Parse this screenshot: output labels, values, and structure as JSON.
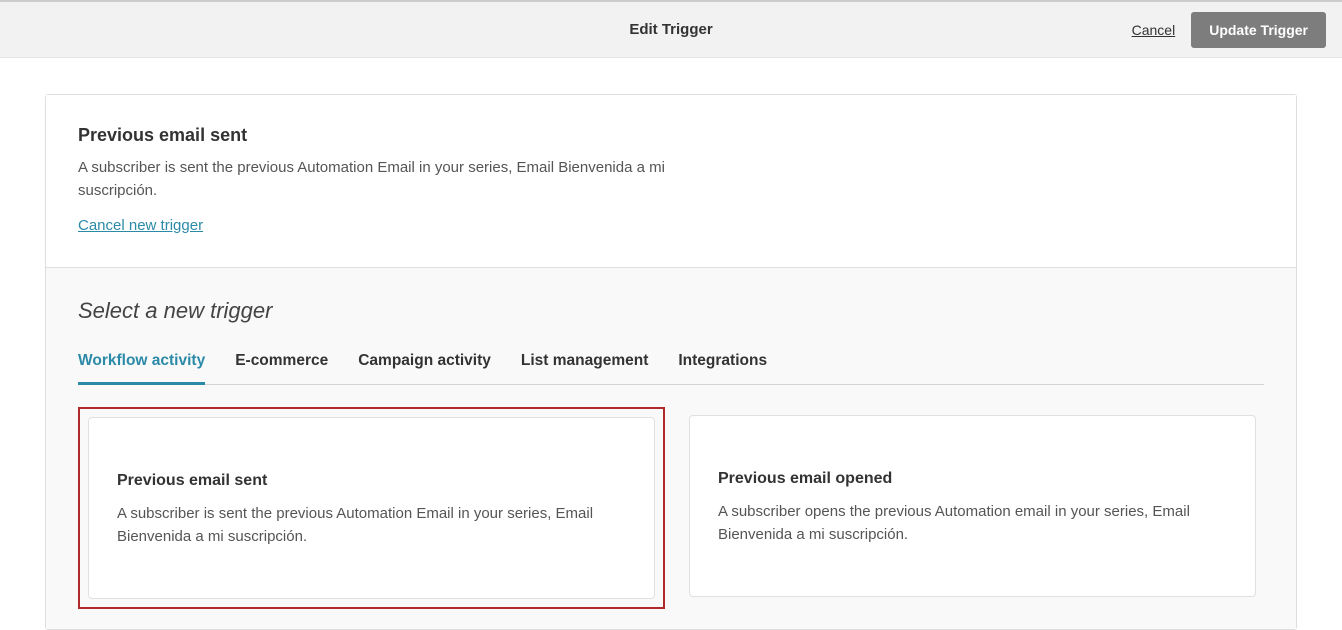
{
  "topbar": {
    "title": "Edit Trigger",
    "cancel": "Cancel",
    "update": "Update Trigger"
  },
  "current": {
    "title": "Previous email sent",
    "description": "A subscriber is sent the previous Automation Email in your series, Email Bienvenida a mi suscripción.",
    "cancel_link": "Cancel new trigger"
  },
  "section_title": "Select a new trigger",
  "tabs": [
    {
      "label": "Workflow activity",
      "active": true
    },
    {
      "label": "E-commerce",
      "active": false
    },
    {
      "label": "Campaign activity",
      "active": false
    },
    {
      "label": "List management",
      "active": false
    },
    {
      "label": "Integrations",
      "active": false
    }
  ],
  "cards": [
    {
      "title": "Previous email sent",
      "description": "A subscriber is sent the previous Automation Email in your series, Email Bienvenida a mi suscripción.",
      "highlight": true
    },
    {
      "title": "Previous email opened",
      "description": "A subscriber opens the previous Automation email in your series, Email Bienvenida a mi suscripción.",
      "highlight": false
    }
  ]
}
